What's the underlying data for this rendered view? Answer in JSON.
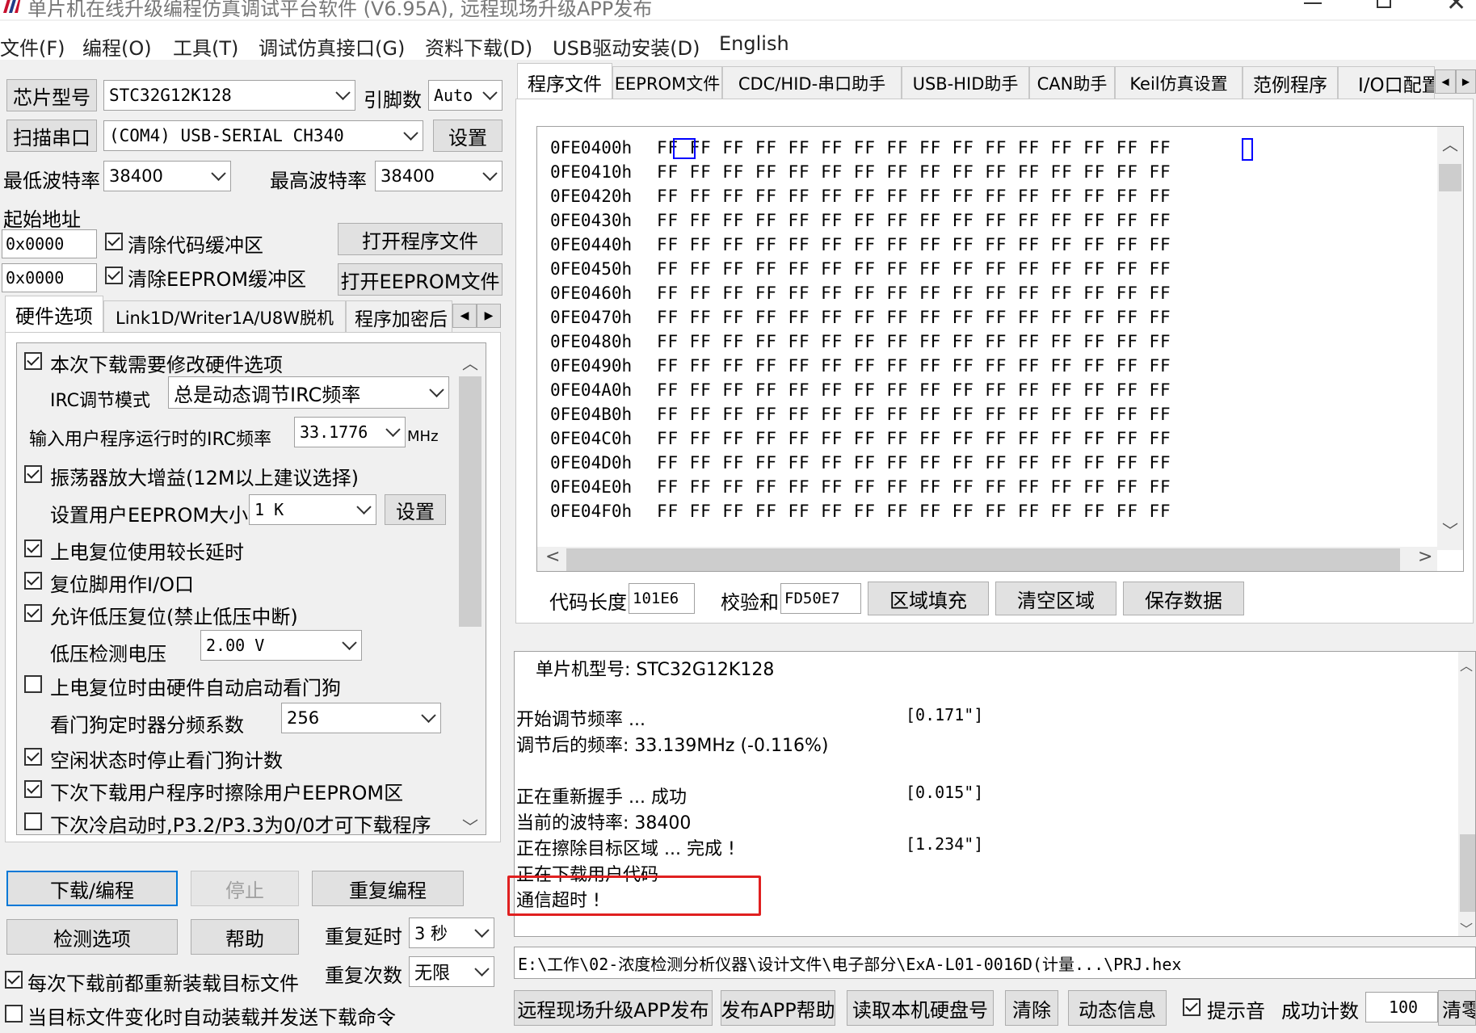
{
  "window": {
    "title": "单片机在线升级编程仿真调试平台软件 (V6.95A), 远程现场升级APP发布"
  },
  "menu": [
    "文件(F)",
    "编程(O)",
    "工具(T)",
    "调试仿真接口(G)",
    "资料下载(D)",
    "USB驱动安装(D)",
    "English"
  ],
  "left": {
    "chip_label": "芯片型号",
    "chip_value": "STC32G12K128",
    "pins_label": "引脚数",
    "pins_value": "Auto",
    "scan_label": "扫描串口",
    "port_value": "(COM4) USB-SERIAL CH340",
    "settings_label": "设置",
    "min_baud_label": "最低波特率",
    "min_baud_value": "38400",
    "max_baud_label": "最高波特率",
    "max_baud_value": "38400",
    "start_addr_label": "起始地址",
    "addr1": "0x0000",
    "clear_code_label": "清除代码缓冲区",
    "open_prog_label": "打开程序文件",
    "addr2": "0x0000",
    "clear_eeprom_label": "清除EEPROM缓冲区",
    "open_eeprom_label": "打开EEPROM文件",
    "subtabs": [
      "硬件选项",
      "Link1D/Writer1A/U8W脱机",
      "程序加密后"
    ],
    "options": {
      "opt1": "本次下载需要修改硬件选项",
      "irc_mode_label": "IRC调节模式",
      "irc_mode_value": "总是动态调节IRC频率",
      "irc_freq_label": "输入用户程序运行时的IRC频率",
      "irc_freq_value": "33.1776",
      "irc_unit": "MHz",
      "opt2": "振荡器放大增益(12M以上建议选择)",
      "eeprom_size_label": "设置用户EEPROM大小",
      "eeprom_size_value": "1   K",
      "eeprom_set": "设置",
      "opt3": "上电复位使用较长延时",
      "opt4": "复位脚用作I/O口",
      "opt5": "允许低压复位(禁止低压中断)",
      "lvd_label": "低压检测电压",
      "lvd_value": "2.00 V",
      "opt6": "上电复位时由硬件自动启动看门狗",
      "wdt_label": "看门狗定时器分频系数",
      "wdt_value": "256",
      "opt7": "空闲状态时停止看门狗计数",
      "opt8": "下次下载用户程序时擦除用户EEPROM区",
      "opt9": "下次冷启动时,P3.2/P3.3为0/0才可下载程序"
    },
    "download_label": "下载/编程",
    "stop_label": "停止",
    "repeat_prog_label": "重复编程",
    "detect_label": "检测选项",
    "help_label": "帮助",
    "repeat_delay_label": "重复延时",
    "repeat_delay_value": "3 秒",
    "repeat_count_label": "重复次数",
    "repeat_count_value": "无限",
    "reload_label": "每次下载前都重新装载目标文件",
    "autoload_label": "当目标文件变化时自动装载并发送下载命令"
  },
  "right": {
    "tabs": [
      "程序文件",
      "EEPROM文件",
      "CDC/HID-串口助手",
      "USB-HID助手",
      "CAN助手",
      "Keil仿真设置",
      "范例程序",
      "I/O口配置"
    ],
    "hex_addresses": [
      "0FE0400h",
      "0FE0410h",
      "0FE0420h",
      "0FE0430h",
      "0FE0440h",
      "0FE0450h",
      "0FE0460h",
      "0FE0470h",
      "0FE0480h",
      "0FE0490h",
      "0FE04A0h",
      "0FE04B0h",
      "0FE04C0h",
      "0FE04D0h",
      "0FE04E0h",
      "0FE04F0h"
    ],
    "hex_line": "FF FF FF FF FF FF FF FF FF FF FF FF FF FF FF FF",
    "code_len_label": "代码长度",
    "code_len_value": "101E6",
    "checksum_label": "校验和",
    "checksum_value": "FD50E7",
    "fill_label": "区域填充",
    "clear_label": "清空区域",
    "save_label": "保存数据",
    "log": {
      "line1": "单片机型号: STC32G12K128",
      "line2": "开始调节频率 ...",
      "line2_t": "[0.171\"]",
      "line3": "调节后的频率: 33.139MHz (-0.116%)",
      "line4": "正在重新握手 ... 成功",
      "line4_t": "[0.015\"]",
      "line5": "当前的波特率: 38400",
      "line6": "正在擦除目标区域 ... 完成 !",
      "line6_t": "[1.234\"]",
      "line7": "正在下载用户代码",
      "line8": "通信超时 !"
    },
    "file_path": "E:\\工作\\02-浓度检测分析仪器\\设计文件\\电子部分\\ExA-L01-0016D(计量...\\PRJ.hex",
    "bottom": {
      "publish": "远程现场升级APP发布",
      "publish_help": "发布APP帮助",
      "read_disk": "读取本机硬盘号",
      "clear": "清除",
      "dyn_info": "动态信息",
      "sound": "提示音",
      "success_label": "成功计数",
      "success_value": "100",
      "clear2": "清零"
    }
  },
  "colors": {
    "highlight_red": "#e02020",
    "focus_blue": "#0000ff",
    "scroll_thumb": "#cdcdcd"
  }
}
